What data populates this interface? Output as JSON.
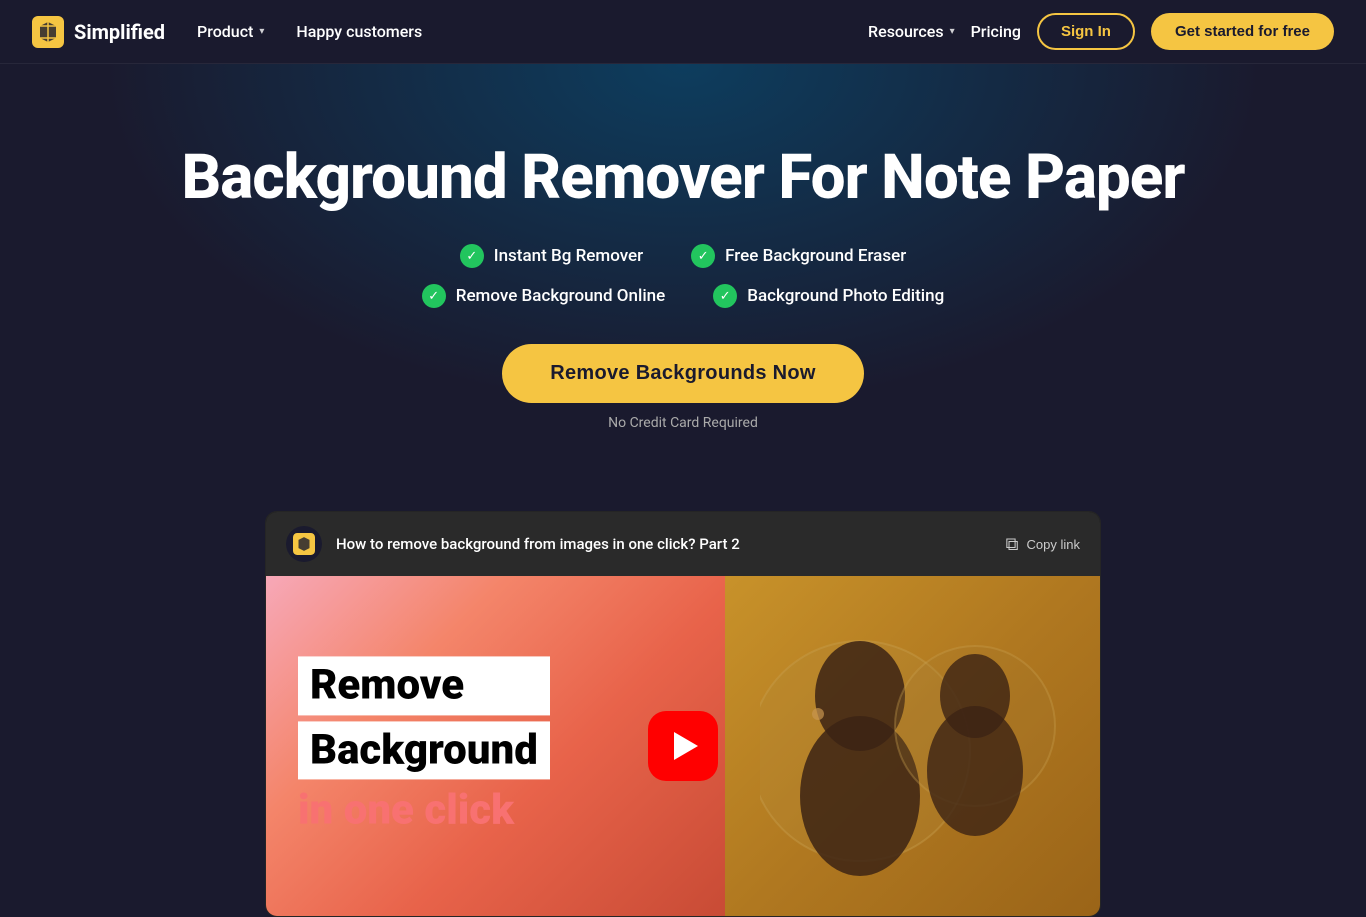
{
  "nav": {
    "logo_text": "Simplified",
    "product_label": "Product",
    "happy_customers_label": "Happy customers",
    "resources_label": "Resources",
    "pricing_label": "Pricing",
    "signin_label": "Sign In",
    "getstarted_label": "Get started for free"
  },
  "hero": {
    "title": "Background Remover For Note Paper",
    "features": [
      {
        "id": "instant-bg",
        "label": "Instant Bg Remover"
      },
      {
        "id": "free-eraser",
        "label": "Free Background Eraser"
      },
      {
        "id": "remove-online",
        "label": "Remove Background Online"
      },
      {
        "id": "photo-editing",
        "label": "Background Photo Editing"
      }
    ],
    "cta_label": "Remove Backgrounds Now",
    "no_credit_label": "No Credit Card Required"
  },
  "video": {
    "logo_alt": "simplified-logo",
    "title": "How to remove background from images in one click? Part 2",
    "copy_link_label": "Copy link",
    "overlay_line1": "Remove",
    "overlay_line2": "Background",
    "overlay_line3": "in one click"
  },
  "colors": {
    "accent": "#f5c542",
    "green": "#22c55e",
    "bg_dark": "#1a1a2e",
    "play_red": "#ff0000"
  }
}
